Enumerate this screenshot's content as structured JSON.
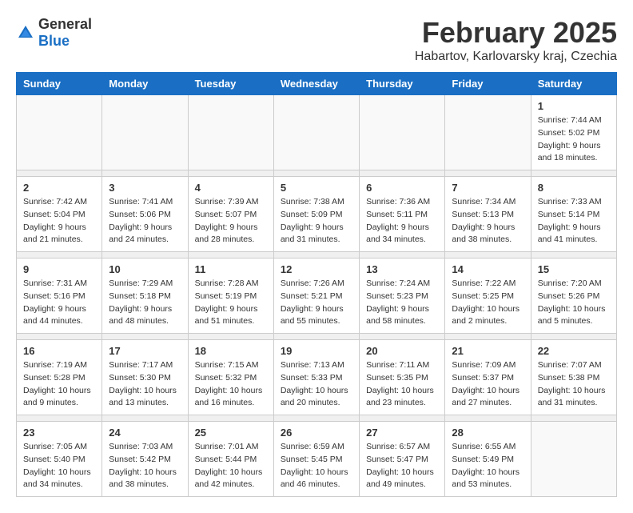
{
  "logo": {
    "general": "General",
    "blue": "Blue"
  },
  "title": "February 2025",
  "subtitle": "Habartov, Karlovarsky kraj, Czechia",
  "days_of_week": [
    "Sunday",
    "Monday",
    "Tuesday",
    "Wednesday",
    "Thursday",
    "Friday",
    "Saturday"
  ],
  "weeks": [
    [
      {
        "day": "",
        "info": ""
      },
      {
        "day": "",
        "info": ""
      },
      {
        "day": "",
        "info": ""
      },
      {
        "day": "",
        "info": ""
      },
      {
        "day": "",
        "info": ""
      },
      {
        "day": "",
        "info": ""
      },
      {
        "day": "1",
        "info": "Sunrise: 7:44 AM\nSunset: 5:02 PM\nDaylight: 9 hours and 18 minutes."
      }
    ],
    [
      {
        "day": "2",
        "info": "Sunrise: 7:42 AM\nSunset: 5:04 PM\nDaylight: 9 hours and 21 minutes."
      },
      {
        "day": "3",
        "info": "Sunrise: 7:41 AM\nSunset: 5:06 PM\nDaylight: 9 hours and 24 minutes."
      },
      {
        "day": "4",
        "info": "Sunrise: 7:39 AM\nSunset: 5:07 PM\nDaylight: 9 hours and 28 minutes."
      },
      {
        "day": "5",
        "info": "Sunrise: 7:38 AM\nSunset: 5:09 PM\nDaylight: 9 hours and 31 minutes."
      },
      {
        "day": "6",
        "info": "Sunrise: 7:36 AM\nSunset: 5:11 PM\nDaylight: 9 hours and 34 minutes."
      },
      {
        "day": "7",
        "info": "Sunrise: 7:34 AM\nSunset: 5:13 PM\nDaylight: 9 hours and 38 minutes."
      },
      {
        "day": "8",
        "info": "Sunrise: 7:33 AM\nSunset: 5:14 PM\nDaylight: 9 hours and 41 minutes."
      }
    ],
    [
      {
        "day": "9",
        "info": "Sunrise: 7:31 AM\nSunset: 5:16 PM\nDaylight: 9 hours and 44 minutes."
      },
      {
        "day": "10",
        "info": "Sunrise: 7:29 AM\nSunset: 5:18 PM\nDaylight: 9 hours and 48 minutes."
      },
      {
        "day": "11",
        "info": "Sunrise: 7:28 AM\nSunset: 5:19 PM\nDaylight: 9 hours and 51 minutes."
      },
      {
        "day": "12",
        "info": "Sunrise: 7:26 AM\nSunset: 5:21 PM\nDaylight: 9 hours and 55 minutes."
      },
      {
        "day": "13",
        "info": "Sunrise: 7:24 AM\nSunset: 5:23 PM\nDaylight: 9 hours and 58 minutes."
      },
      {
        "day": "14",
        "info": "Sunrise: 7:22 AM\nSunset: 5:25 PM\nDaylight: 10 hours and 2 minutes."
      },
      {
        "day": "15",
        "info": "Sunrise: 7:20 AM\nSunset: 5:26 PM\nDaylight: 10 hours and 5 minutes."
      }
    ],
    [
      {
        "day": "16",
        "info": "Sunrise: 7:19 AM\nSunset: 5:28 PM\nDaylight: 10 hours and 9 minutes."
      },
      {
        "day": "17",
        "info": "Sunrise: 7:17 AM\nSunset: 5:30 PM\nDaylight: 10 hours and 13 minutes."
      },
      {
        "day": "18",
        "info": "Sunrise: 7:15 AM\nSunset: 5:32 PM\nDaylight: 10 hours and 16 minutes."
      },
      {
        "day": "19",
        "info": "Sunrise: 7:13 AM\nSunset: 5:33 PM\nDaylight: 10 hours and 20 minutes."
      },
      {
        "day": "20",
        "info": "Sunrise: 7:11 AM\nSunset: 5:35 PM\nDaylight: 10 hours and 23 minutes."
      },
      {
        "day": "21",
        "info": "Sunrise: 7:09 AM\nSunset: 5:37 PM\nDaylight: 10 hours and 27 minutes."
      },
      {
        "day": "22",
        "info": "Sunrise: 7:07 AM\nSunset: 5:38 PM\nDaylight: 10 hours and 31 minutes."
      }
    ],
    [
      {
        "day": "23",
        "info": "Sunrise: 7:05 AM\nSunset: 5:40 PM\nDaylight: 10 hours and 34 minutes."
      },
      {
        "day": "24",
        "info": "Sunrise: 7:03 AM\nSunset: 5:42 PM\nDaylight: 10 hours and 38 minutes."
      },
      {
        "day": "25",
        "info": "Sunrise: 7:01 AM\nSunset: 5:44 PM\nDaylight: 10 hours and 42 minutes."
      },
      {
        "day": "26",
        "info": "Sunrise: 6:59 AM\nSunset: 5:45 PM\nDaylight: 10 hours and 46 minutes."
      },
      {
        "day": "27",
        "info": "Sunrise: 6:57 AM\nSunset: 5:47 PM\nDaylight: 10 hours and 49 minutes."
      },
      {
        "day": "28",
        "info": "Sunrise: 6:55 AM\nSunset: 5:49 PM\nDaylight: 10 hours and 53 minutes."
      },
      {
        "day": "",
        "info": ""
      }
    ]
  ]
}
